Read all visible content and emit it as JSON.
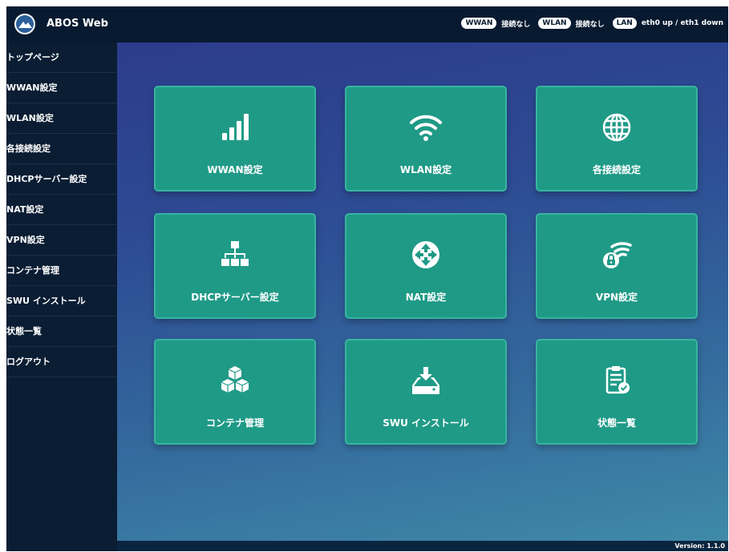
{
  "header": {
    "title": "ABOS Web",
    "status": [
      {
        "badge": "WWAN",
        "text": "接続なし"
      },
      {
        "badge": "WLAN",
        "text": "接続なし"
      },
      {
        "badge": "LAN",
        "text": "eth0 up / eth1 down"
      }
    ]
  },
  "sidebar": {
    "items": [
      {
        "label": "トップページ"
      },
      {
        "label": "WWAN設定"
      },
      {
        "label": "WLAN設定"
      },
      {
        "label": "各接続設定"
      },
      {
        "label": "DHCPサーバー設定"
      },
      {
        "label": "NAT設定"
      },
      {
        "label": "VPN設定"
      },
      {
        "label": "コンテナ管理"
      },
      {
        "label": "SWU インストール"
      },
      {
        "label": "状態一覧"
      },
      {
        "label": "ログアウト"
      }
    ]
  },
  "cards": [
    {
      "label": "WWAN設定",
      "icon": "signal-bars-icon"
    },
    {
      "label": "WLAN設定",
      "icon": "wifi-icon"
    },
    {
      "label": "各接続設定",
      "icon": "globe-icon"
    },
    {
      "label": "DHCPサーバー設定",
      "icon": "network-tree-icon"
    },
    {
      "label": "NAT設定",
      "icon": "router-arrows-icon"
    },
    {
      "label": "VPN設定",
      "icon": "wifi-lock-icon"
    },
    {
      "label": "コンテナ管理",
      "icon": "containers-icon"
    },
    {
      "label": "SWU インストール",
      "icon": "download-tray-icon"
    },
    {
      "label": "状態一覧",
      "icon": "clipboard-check-icon"
    }
  ],
  "footer": {
    "version": "Version: 1.1.0"
  },
  "colors": {
    "topbar": "#081a30",
    "sidebar": "#0a1d33",
    "card": "#1f9a87",
    "card_border": "#37b59f"
  }
}
